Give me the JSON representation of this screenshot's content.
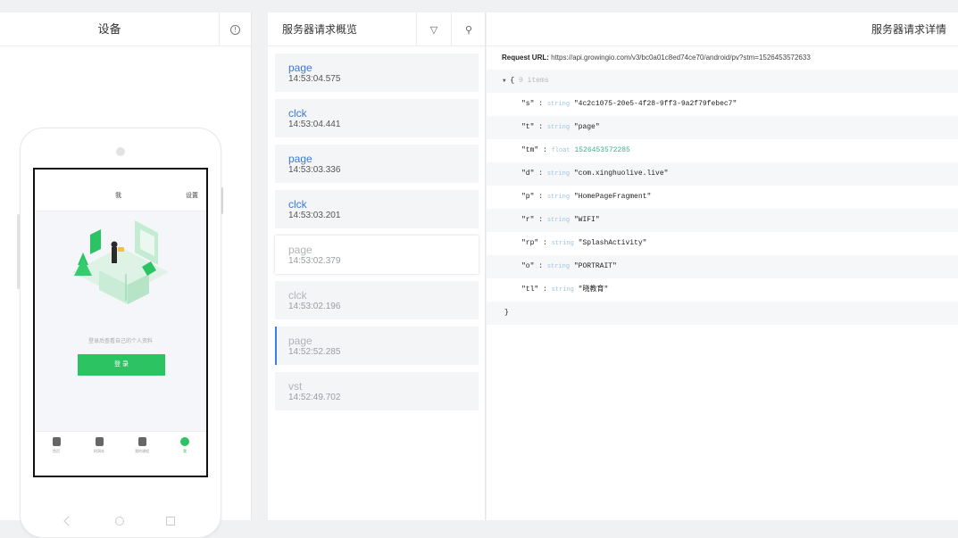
{
  "device_panel": {
    "title": "设备",
    "info_icon": "info-icon"
  },
  "phone_screen": {
    "me_label": "我",
    "settings_label": "设置",
    "hint": "登录后查看自己的个人资料",
    "login_button": "登 录",
    "nav": [
      {
        "label": "首页",
        "icon": "home-icon"
      },
      {
        "label": "树洞本",
        "icon": "tree-icon"
      },
      {
        "label": "我的课程",
        "icon": "book-icon"
      },
      {
        "label": "我",
        "icon": "user-icon"
      }
    ]
  },
  "overview_panel": {
    "title": "服务器请求概览",
    "filter_icon": "filter-icon",
    "clear_icon": "clear-icon",
    "items": [
      {
        "name": "page",
        "time": "14:53:04.575"
      },
      {
        "name": "clck",
        "time": "14:53:04.441"
      },
      {
        "name": "page",
        "time": "14:53:03.336"
      },
      {
        "name": "clck",
        "time": "14:53:03.201"
      },
      {
        "name": "page",
        "time": "14:53:02.379"
      },
      {
        "name": "clck",
        "time": "14:53:02.196"
      },
      {
        "name": "page",
        "time": "14:52:52.285"
      },
      {
        "name": "vst",
        "time": "14:52:49.702"
      }
    ]
  },
  "detail_panel": {
    "title": "服务器请求详情",
    "url_label": "Request URL:",
    "url": "https://api.growingio.com/v3/bc0a01c8ed74ce70/android/pv?stm=1526453572633",
    "open": "{",
    "count": "9 items",
    "close": "}",
    "fields": [
      {
        "key": "\"s\"",
        "type": "string",
        "value": "\"4c2c1075-20e5-4f28-9ff3-9a2f79febec7\""
      },
      {
        "key": "\"t\"",
        "type": "string",
        "value": "\"page\""
      },
      {
        "key": "\"tm\"",
        "type": "float",
        "value": "1526453572285"
      },
      {
        "key": "\"d\"",
        "type": "string",
        "value": "\"com.xinghuolive.live\""
      },
      {
        "key": "\"p\"",
        "type": "string",
        "value": "\"HomePageFragment\""
      },
      {
        "key": "\"r\"",
        "type": "string",
        "value": "\"WIFI\""
      },
      {
        "key": "\"rp\"",
        "type": "string",
        "value": "\"SplashActivity\""
      },
      {
        "key": "\"o\"",
        "type": "string",
        "value": "\"PORTRAIT\""
      },
      {
        "key": "\"tl\"",
        "type": "string",
        "value": "\"晓教育\""
      }
    ]
  }
}
